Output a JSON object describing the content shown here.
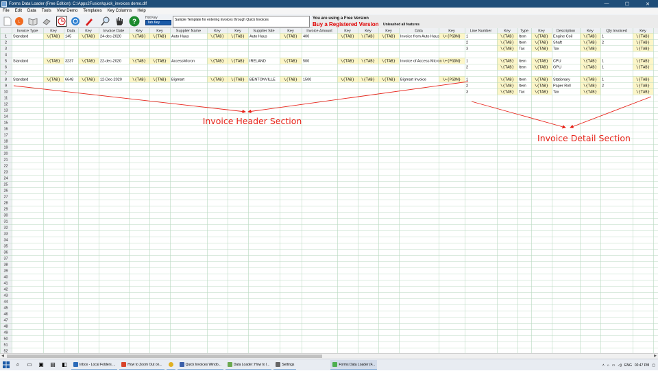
{
  "window": {
    "title": "Forms Data Loader (Free Edition): C:\\Apps2Fusion\\quick_invoices demo.dlf",
    "min": "—",
    "max": "☐",
    "close": "✕"
  },
  "menu": [
    "File",
    "Edit",
    "Data",
    "Tools",
    "View Demo",
    "Templates",
    "Key Columns",
    "Help"
  ],
  "toolbar": {
    "icons": [
      "new-file-icon",
      "load-icon",
      "open-book-icon",
      "eraser-icon",
      "clock-icon",
      "refresh-icon",
      "pen-icon",
      "search-icon",
      "hand-icon",
      "help-icon"
    ],
    "hot_key_label": "Hot Key",
    "hot_key_value": "Tab Key",
    "description": "Sample Template for entering invoices through Quick Invoices"
  },
  "banner": {
    "line1": "You are using a Free Version",
    "line2": "Buy a Registered Version",
    "line3": "Unleashed all features"
  },
  "columns": [
    "Invoice Type",
    "Key",
    "Data",
    "Key",
    "Invoice Date",
    "Key",
    "Key",
    "Supplier Name",
    "Key",
    "Key",
    "Supplier Site",
    "Key",
    "Invoice Amount",
    "Key",
    "Key",
    "Key",
    "Data",
    "Key",
    "Line Number",
    "Key",
    "Type",
    "Key",
    "Description",
    "Key",
    "Qty Invoiced",
    "Key"
  ],
  "rows": [
    [
      "Standard",
      "\\{TAB}",
      "145",
      "\\{TAB}",
      "24-dec-2020",
      "\\{TAB}",
      "\\{TAB}",
      "Auto Haus",
      "\\{TAB}",
      "\\{TAB}",
      "Auto Haus",
      "\\{TAB}",
      "400",
      "\\{TAB}",
      "\\{TAB}",
      "\\{TAB}",
      "Invoice from Auto Haus",
      "\\+{PGDN}",
      "1",
      "\\{TAB}",
      "Item",
      "\\{TAB}",
      "Engine Coil",
      "\\{TAB}",
      "1",
      "\\{TAB}"
    ],
    [
      "",
      "",
      "",
      "",
      "",
      "",
      "",
      "",
      "",
      "",
      "",
      "",
      "",
      "",
      "",
      "",
      "",
      "",
      "2",
      "\\{TAB}",
      "Item",
      "\\{TAB}",
      "Shaft",
      "\\{TAB}",
      "2",
      "\\{TAB}"
    ],
    [
      "",
      "",
      "",
      "",
      "",
      "",
      "",
      "",
      "",
      "",
      "",
      "",
      "",
      "",
      "",
      "",
      "",
      "",
      "3",
      "\\{TAB}",
      "Tax",
      "\\{TAB}",
      "Tax",
      "\\{TAB}",
      "",
      "\\{TAB}"
    ],
    [],
    [
      "Standard",
      "\\{TAB}",
      "3237",
      "\\{TAB}",
      "22-dec-2020",
      "\\{TAB}",
      "\\{TAB}",
      "AccessMicron",
      "\\{TAB}",
      "\\{TAB}",
      "IRELAND",
      "\\{TAB}",
      "500",
      "\\{TAB}",
      "\\{TAB}",
      "\\{TAB}",
      "Invoice of Access Micron",
      "\\+{PGDN}",
      "1",
      "\\{TAB}",
      "Item",
      "\\{TAB}",
      "CPU",
      "\\{TAB}",
      "1",
      "\\{TAB}"
    ],
    [
      "",
      "",
      "",
      "",
      "",
      "",
      "",
      "",
      "",
      "",
      "",
      "",
      "",
      "",
      "",
      "",
      "",
      "",
      "2",
      "\\{TAB}",
      "Item",
      "\\{TAB}",
      "GPU",
      "\\{TAB}",
      "1",
      "\\{TAB}"
    ],
    [],
    [
      "Standard",
      "\\{TAB}",
      "6648",
      "\\{TAB}",
      "12-Dec-2020",
      "\\{TAB}",
      "\\{TAB}",
      "Bigmart",
      "\\{TAB}",
      "\\{TAB}",
      "BENTONVILLE",
      "\\{TAB}",
      "1500",
      "\\{TAB}",
      "\\{TAB}",
      "\\{TAB}",
      "Bigmart Invoice",
      "\\+{PGDN}",
      "1",
      "\\{TAB}",
      "Item",
      "\\{TAB}",
      "Stationary",
      "\\{TAB}",
      "1",
      "\\{TAB}"
    ],
    [
      "",
      "",
      "",
      "",
      "",
      "",
      "",
      "",
      "",
      "",
      "",
      "",
      "",
      "",
      "",
      "",
      "",
      "",
      "2",
      "\\{TAB}",
      "Item",
      "\\{TAB}",
      "Paper Roll",
      "\\{TAB}",
      "2",
      "\\{TAB}"
    ],
    [
      "",
      "",
      "",
      "",
      "",
      "",
      "",
      "",
      "",
      "",
      "",
      "",
      "",
      "",
      "",
      "",
      "",
      "",
      "3",
      "\\{TAB}",
      "Tax",
      "\\{TAB}",
      "Tax",
      "\\{TAB}",
      "",
      "\\{TAB}"
    ]
  ],
  "row_count": 52,
  "annotations": {
    "header_label": "Invoice Header Section",
    "detail_label": "Invoice Detail Section",
    "color": "#e8241a"
  },
  "taskbar": {
    "tasks": [
      {
        "label": "Inbox - Local Folders ...",
        "icon": "email-icon",
        "color": "#2a6ab8"
      },
      {
        "label": "How to Zoom Out on...",
        "icon": "browser-icon",
        "color": "#d8442a"
      },
      {
        "label": "",
        "icon": "chrome-icon",
        "color": "#e0b020"
      },
      {
        "label": "Quick Invoices Windo...",
        "icon": "document-icon",
        "color": "#3b5fa8"
      },
      {
        "label": "Data Loader: How to l...",
        "icon": "notepad-icon",
        "color": "#6aa84f"
      },
      {
        "label": "Settings",
        "icon": "settings-icon",
        "color": "#666666"
      },
      {
        "label": "Forms Data Loader (F...",
        "icon": "loader-icon",
        "color": "#4caf50"
      }
    ],
    "tray_lang": "ENG",
    "tray_time": "02:47 PM"
  }
}
